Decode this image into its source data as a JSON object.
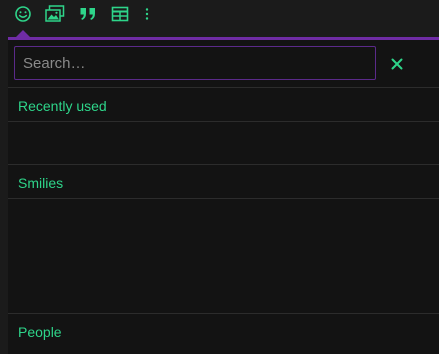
{
  "toolbar": {
    "accent_color": "#2ed58a",
    "buttons": [
      {
        "icon": "smiley-icon"
      },
      {
        "icon": "image-icon"
      },
      {
        "icon": "quote-icon"
      },
      {
        "icon": "table-icon"
      },
      {
        "icon": "more-vertical-icon"
      }
    ]
  },
  "emoji_picker": {
    "border_color": "#6f2ca5",
    "search": {
      "value": "",
      "placeholder": "Search…"
    },
    "clear_icon": "close-icon",
    "sections": [
      {
        "title": "Recently used"
      },
      {
        "title": "Smilies"
      },
      {
        "title": "People"
      }
    ]
  }
}
